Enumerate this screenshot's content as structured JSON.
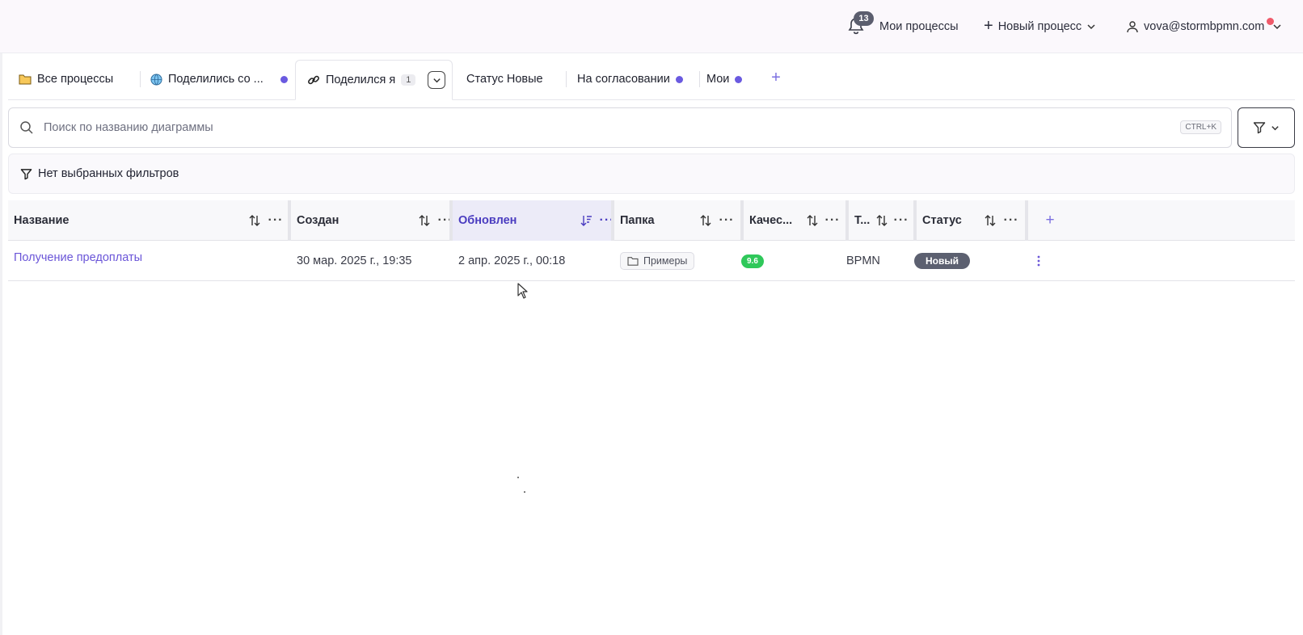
{
  "topbar": {
    "notifications_count": "13",
    "my_processes": "Мои процессы",
    "new_process": "Новый процесс",
    "user_email": "vova@stormbpmn.com"
  },
  "tabs": [
    {
      "label": "Все процессы",
      "icon": "folder-icon"
    },
    {
      "label": "Поделились со ...",
      "icon": "globe-icon",
      "dot": true
    },
    {
      "label": "Поделился я",
      "icon": "link-icon",
      "count": "1",
      "active": true
    },
    {
      "label": "Статус Новые"
    },
    {
      "label": "На согласовании",
      "dot": true
    },
    {
      "label": "Мои",
      "dot": true
    }
  ],
  "search": {
    "placeholder": "Поиск по названию диаграммы",
    "shortcut": "CTRL+K"
  },
  "filters": {
    "empty_label": "Нет выбранных фильтров"
  },
  "table": {
    "columns": [
      "Название",
      "Создан",
      "Обновлен",
      "Папка",
      "Качес...",
      "Т...",
      "Статус"
    ],
    "sorted_column": "Обновлен",
    "rows": [
      {
        "name": "Получение предоплаты",
        "created": "30 мар. 2025 г., 19:35",
        "updated": "2 апр. 2025 г., 00:18",
        "folder": "Примеры",
        "quality": "9.6",
        "type": "BPMN",
        "status": "Новый"
      }
    ]
  },
  "colors": {
    "accent": "#6a55d8",
    "quality_green": "#2fc85a",
    "status_gray": "#5c6070",
    "notification_dot": "#f05a6a"
  }
}
